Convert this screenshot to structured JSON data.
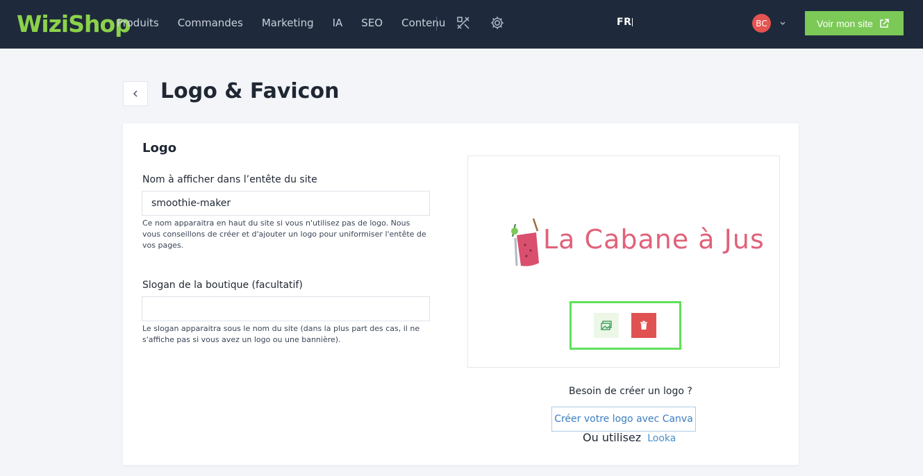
{
  "brand": {
    "name": "WiziShop",
    "color": "#8bd24a"
  },
  "nav": {
    "items": [
      "Produits",
      "Commandes",
      "Marketing",
      "IA",
      "SEO",
      "Contenu"
    ],
    "tools_icon": "tools-icon",
    "settings_icon": "gear-icon"
  },
  "header": {
    "language": "FR",
    "avatar_initials": "BC",
    "view_site_label": "Voir mon site"
  },
  "page": {
    "title": "Logo & Favicon"
  },
  "card": {
    "title": "Logo",
    "name_field": {
      "label": "Nom à afficher dans l’entête du site",
      "value": "smoothie-maker",
      "help": "Ce nom apparaitra en haut du site si vous n'utilisez pas de logo. Nous vous conseillons de créer et d'ajouter un logo pour uniformiser l'entête de vos pages."
    },
    "slogan_field": {
      "label": "Slogan de la boutique (facultatif)",
      "value": "",
      "help": "Le slogan apparaitra sous le nom du site (dans la plus part des cas, il ne s'affiche pas si vous avez un logo ou une bannière)."
    },
    "preview": {
      "logo_text": "La Cabane à Jus"
    },
    "need_logo_text": "Besoin de créer un logo ?",
    "canva_button_label": "Créer votre logo avec Canva",
    "or_use_text": "Ou utilisez",
    "looka_link": "Looka"
  },
  "colors": {
    "topbar": "#1e2a3b",
    "accent_green": "#7cc957",
    "danger": "#e05252",
    "link": "#4a90c8"
  }
}
